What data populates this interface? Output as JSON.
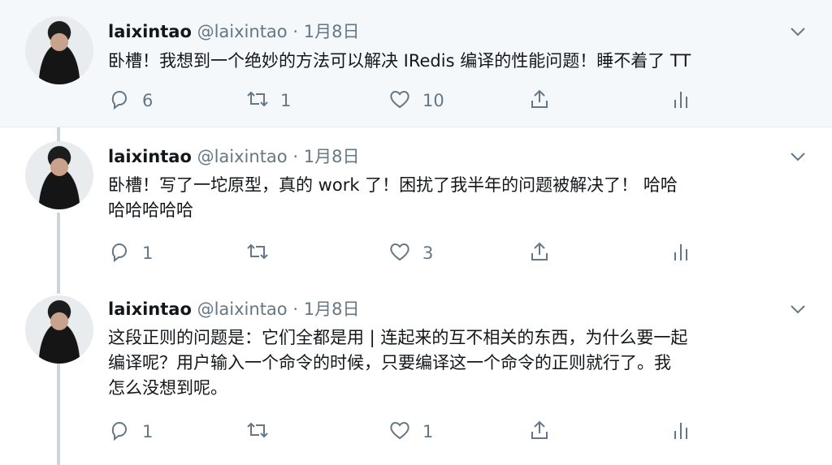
{
  "tweets": [
    {
      "name": "laixintao",
      "handle": "@laixintao",
      "dot": "·",
      "time": "1月8日",
      "lines": [
        "卧槽！我想到一个绝妙的方法可以解决 IRedis 编译的性能问题！睡不着了 TT"
      ],
      "reply_count": "6",
      "retweet_count": "1",
      "like_count": "10"
    },
    {
      "name": "laixintao",
      "handle": "@laixintao",
      "dot": "·",
      "time": "1月8日",
      "lines": [
        "卧槽！写了一坨原型，真的 work 了！困扰了我半年的问题被解决了！ 哈哈",
        "哈哈哈哈哈"
      ],
      "reply_count": "1",
      "retweet_count": "",
      "like_count": "3"
    },
    {
      "name": "laixintao",
      "handle": "@laixintao",
      "dot": "·",
      "time": "1月8日",
      "lines": [
        "这段正则的问题是：它们全都是用 | 连起来的互不相关的东西，为什么要一起",
        "编译呢？用户输入一个命令的时候，只要编译这一个命令的正则就行了。我",
        "怎么没想到呢。"
      ],
      "reply_count": "1",
      "retweet_count": "",
      "like_count": "1"
    }
  ],
  "icons": {
    "caret": "chevron-down-icon",
    "reply": "reply-icon",
    "retweet": "retweet-icon",
    "like": "heart-icon",
    "share": "share-icon",
    "analytics": "analytics-icon"
  },
  "colors": {
    "text": "#14171a",
    "secondary": "#657786",
    "thread_line": "#ccd6dd",
    "highlight_bg": "#f5f8fa"
  }
}
